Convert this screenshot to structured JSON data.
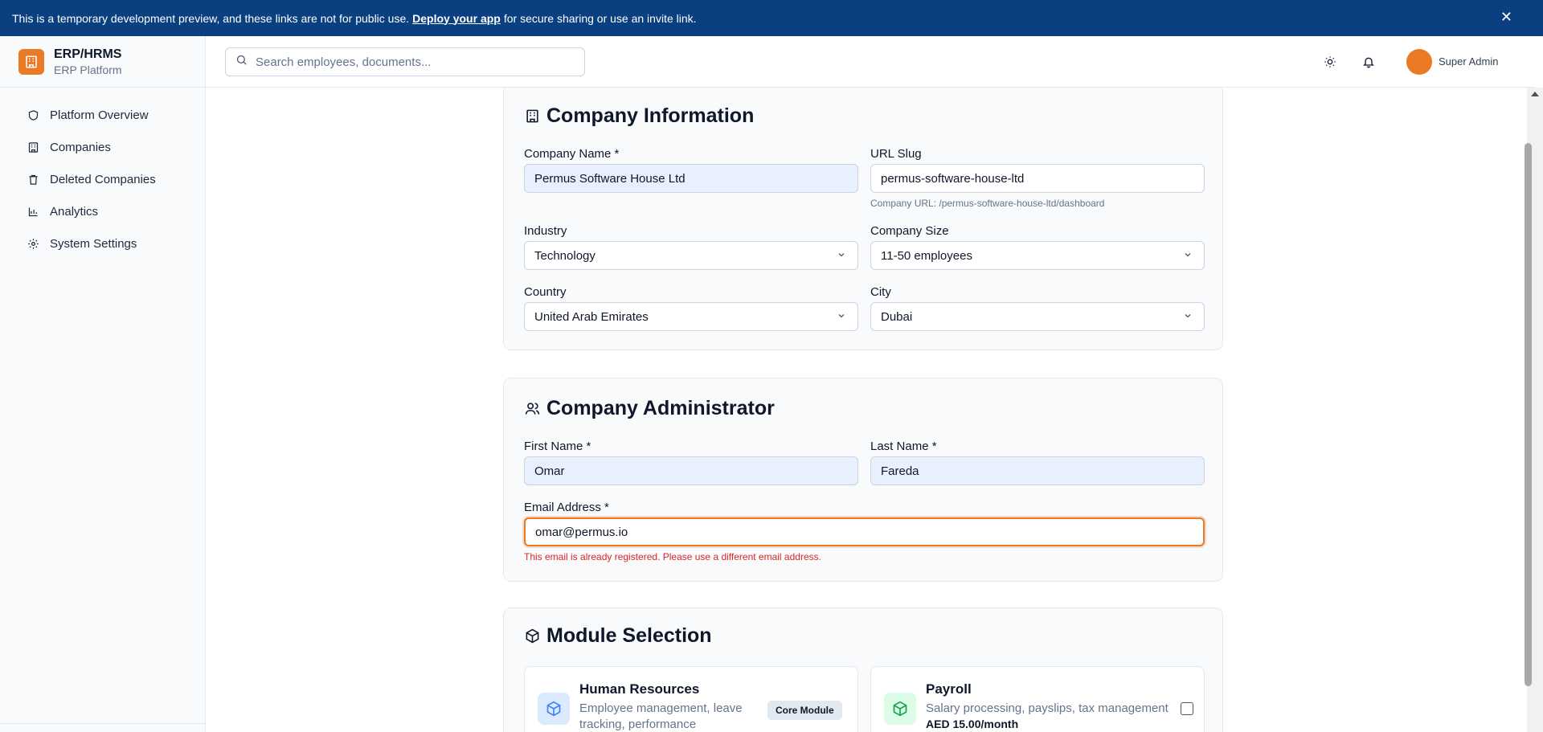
{
  "banner": {
    "text_before": "This is a temporary development preview, and these links are not for public use.",
    "link": "Deploy your app",
    "text_after": "for secure sharing or use an invite link.",
    "close": "✕"
  },
  "brand": {
    "title": "ERP/HRMS",
    "subtitle": "ERP Platform"
  },
  "sidebar": {
    "items": [
      {
        "label": "Platform Overview",
        "icon": "shield-icon"
      },
      {
        "label": "Companies",
        "icon": "building-icon"
      },
      {
        "label": "Deleted Companies",
        "icon": "trash-icon"
      },
      {
        "label": "Analytics",
        "icon": "bar-chart-icon"
      },
      {
        "label": "System Settings",
        "icon": "gear-icon"
      }
    ]
  },
  "header": {
    "search_placeholder": "Search employees, documents...",
    "user_name": "Super Admin",
    "avatar_color": "#ea7a26"
  },
  "company_info": {
    "title": "Company Information",
    "company_name_label": "Company Name *",
    "company_name": "Permus Software House Ltd",
    "slug_label": "URL Slug",
    "slug": "permus-software-house-ltd",
    "slug_helper": "Company URL: /permus-software-house-ltd/dashboard",
    "industry_label": "Industry",
    "industry": "Technology",
    "size_label": "Company Size",
    "size": "11-50 employees",
    "country_label": "Country",
    "country": "United Arab Emirates",
    "city_label": "City",
    "city": "Dubai"
  },
  "admin": {
    "title": "Company Administrator",
    "first_name_label": "First Name *",
    "first_name": "Omar",
    "last_name_label": "Last Name *",
    "last_name": "Fareda",
    "email_label": "Email Address *",
    "email": "omar@permus.io",
    "email_error": "This email is already registered. Please use a different email address."
  },
  "modules": {
    "title": "Module Selection",
    "items": [
      {
        "name": "Human Resources",
        "description": "Employee management, leave tracking, performance",
        "badge": "Core Module",
        "icon_color": "#3b82f6"
      },
      {
        "name": "Payroll",
        "description": "Salary processing, payslips, tax management",
        "price": "AED 15.00/month",
        "icon_color": "#16a34a"
      }
    ]
  },
  "colors": {
    "banner": "#0a3f80",
    "accent": "#ea7a26",
    "error": "#dc2626"
  }
}
